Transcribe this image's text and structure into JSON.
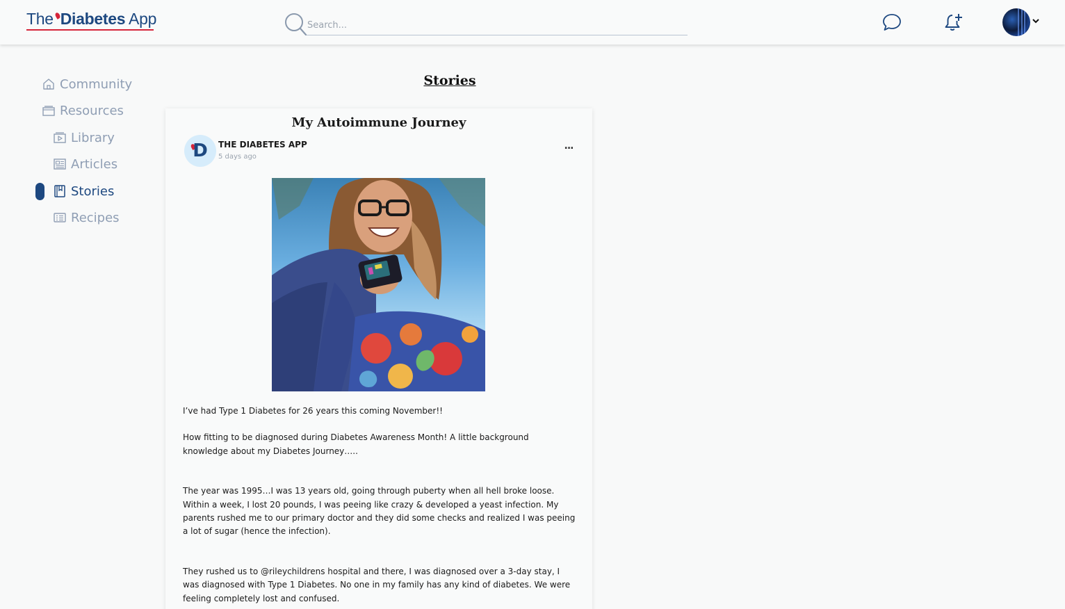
{
  "header": {
    "logo_the": "The",
    "logo_diabetes": "Diabetes",
    "logo_app": "App",
    "search_placeholder": "Search...",
    "icons": [
      "search-icon",
      "chat-bubble-icon",
      "bell-plus-icon",
      "chevron-down-icon"
    ],
    "accent_color": "#1d4880",
    "brand_red": "#d6243a"
  },
  "sidebar": {
    "items": [
      {
        "label": "Community",
        "icon": "home-icon"
      },
      {
        "label": "Resources",
        "icon": "folder-icon"
      },
      {
        "label": "Library",
        "icon": "video-folder-icon"
      },
      {
        "label": "Articles",
        "icon": "newspaper-icon"
      },
      {
        "label": "Stories",
        "icon": "book-icon",
        "active": true
      },
      {
        "label": "Recipes",
        "icon": "recipe-card-icon"
      }
    ]
  },
  "main": {
    "page_title": "Stories",
    "post": {
      "title": "My Autoimmune Journey",
      "author_initial": "D",
      "author": "THE DIABETES APP",
      "time": "5 days ago",
      "more_label": "...",
      "paragraphs": [
        "I’ve had Type 1 Diabetes for 26 years this coming November!!",
        "How fitting to be diagnosed during Diabetes Awareness Month! A little background knowledge about my Diabetes Journey…..",
        "The year was 1995…I was 13 years old, going through puberty when all hell broke loose. Within a week, I lost 20 pounds, I was peeing like crazy & developed a yeast infection. My parents rushed me to our primary doctor and they did some checks and realized I was peeing a lot of sugar (hence the infection).",
        "They rushed us to @rileychildrens hospital and there, I was diagnosed over a 3-day stay, I was diagnosed with Type 1 Diabetes. No one in my family has any kind of diabetes. We were feeling completely lost and confused."
      ]
    }
  }
}
